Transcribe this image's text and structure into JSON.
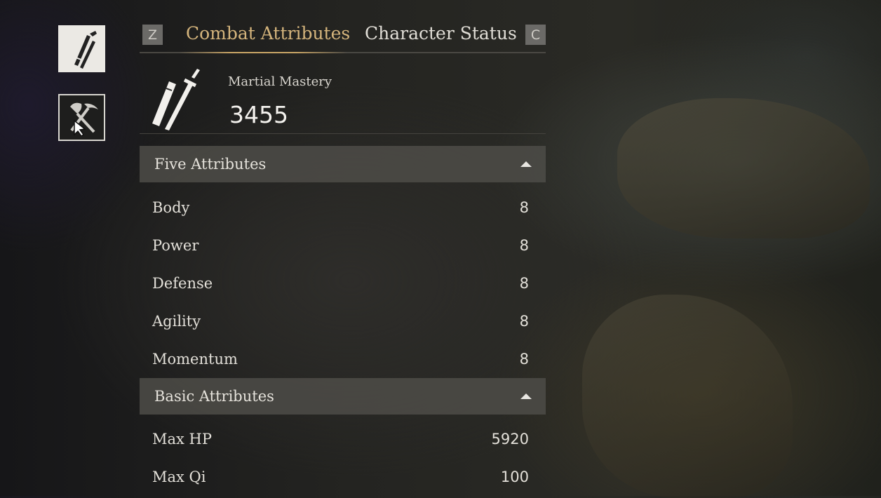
{
  "side_tabs": [
    {
      "icon": "sword-scabbard-icon",
      "state": "active"
    },
    {
      "icon": "shovel-pickaxe-icon",
      "state": "inactive"
    }
  ],
  "tabs": {
    "prev_key": "Z",
    "next_key": "C",
    "items": [
      {
        "label": "Combat Attributes",
        "active": true
      },
      {
        "label": "Character Status",
        "active": false
      }
    ]
  },
  "mastery": {
    "icon": "sword-scabbard-icon",
    "label": "Martial Mastery",
    "value": "3455"
  },
  "sections": [
    {
      "title": "Five Attributes",
      "rows": [
        {
          "name": "Body",
          "value": "8"
        },
        {
          "name": "Power",
          "value": "8"
        },
        {
          "name": "Defense",
          "value": "8"
        },
        {
          "name": "Agility",
          "value": "8"
        },
        {
          "name": "Momentum",
          "value": "8"
        }
      ]
    },
    {
      "title": "Basic Attributes",
      "rows": [
        {
          "name": "Max HP",
          "value": "5920"
        },
        {
          "name": "Max Qi",
          "value": "100"
        }
      ]
    }
  ],
  "colors": {
    "accent_gold": "#d4b47c",
    "section_bg": "#4e4c48"
  }
}
